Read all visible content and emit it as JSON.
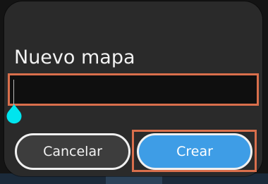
{
  "dialog": {
    "title": "Nuevo mapa",
    "name_input": {
      "value": "",
      "placeholder": ""
    },
    "buttons": {
      "cancel_label": "Cancelar",
      "create_label": "Crear"
    }
  },
  "colors": {
    "dialog_background": "#2a2a2a",
    "input_background": "#0f0f0f",
    "highlight_outline": "#d96f4c",
    "cancel_button": "#3d3d3d",
    "create_button": "#3e9de6",
    "caret_handle": "#00e5ee"
  }
}
